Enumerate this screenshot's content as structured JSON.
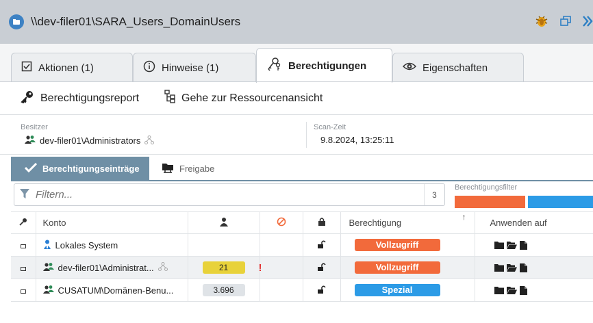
{
  "window": {
    "title": "\\\\dev-filer01\\SARA_Users_DomainUsers"
  },
  "tabs": [
    {
      "label": "Aktionen (1)",
      "icon": "checkbox-icon"
    },
    {
      "label": "Hinweise (1)",
      "icon": "info-icon"
    },
    {
      "label": "Berechtigungen",
      "icon": "keys-icon"
    },
    {
      "label": "Eigenschaften",
      "icon": "eye-icon"
    }
  ],
  "actions": {
    "report": "Berechtigungsreport",
    "resource_view": "Gehe zur Ressourcenansicht"
  },
  "info": {
    "owner_label": "Besitzer",
    "owner_value": "dev-filer01\\Administrators",
    "scan_label": "Scan-Zeit",
    "scan_value": "9.8.2024, 13:25:11"
  },
  "subtabs": {
    "entries": "Berechtigungseinträge",
    "share": "Freigabe"
  },
  "filter": {
    "placeholder": "Filtern...",
    "count": "3",
    "permission_filter_label": "Berechtigungsfilter"
  },
  "table": {
    "headers": {
      "account": "Konto",
      "permission": "Berechtigung",
      "apply_to": "Anwenden auf"
    },
    "rows": [
      {
        "account": "Lokales System",
        "count": "",
        "permission": "Vollzugriff",
        "perm_color": "#f26a3b"
      },
      {
        "account": "dev-filer01\\Administrat...",
        "count": "21",
        "count_bg": "#e8d23a",
        "warning": "!",
        "permission": "Vollzugriff",
        "perm_color": "#f26a3b"
      },
      {
        "account": "CUSATUM\\Domänen-Benu...",
        "count": "3.696",
        "count_bg": "#dfe3e7",
        "permission": "Spezial",
        "perm_color": "#2c9be6"
      }
    ]
  },
  "colors": {
    "accent": "#6f8fa5",
    "full_access": "#f26a3b",
    "special": "#2c9be6"
  }
}
